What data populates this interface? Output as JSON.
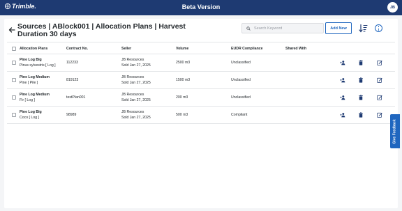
{
  "header": {
    "logo_text": "Trimble.",
    "app_title": "Beta Version",
    "avatar_initials": "JB"
  },
  "page": {
    "title": "Sources | ABlock001 | Allocation Plans | Harvest Duration 30 days",
    "search_placeholder": "Search Keyword",
    "add_button_label": "Add New"
  },
  "table": {
    "columns": {
      "plans": "Allocation Plans",
      "contract": "Contract No.",
      "seller": "Seller",
      "volume": "Volume",
      "eudr": "EUDR Compliance",
      "shared": "Shared With"
    },
    "rows": [
      {
        "name": "Pine Log Big",
        "species": "Pinus sylvestris [ Log ]",
        "contract": "112233",
        "seller": "JB Resources",
        "sold": "Sold Jan 27, 2025",
        "volume": "2500 m3",
        "eudr": "Unclassified",
        "shared": ""
      },
      {
        "name": "Pine Log Medium",
        "species": "Pine [ Pile ]",
        "contract": "819123",
        "seller": "JB Resources",
        "sold": "Sold Jan 27, 2025",
        "volume": "1500 m3",
        "eudr": "Unclassified",
        "shared": ""
      },
      {
        "name": "Pine Log Medium",
        "species": "Fir [ Log ]",
        "contract": "testPlan001",
        "seller": "JB Resources",
        "sold": "Sold Jan 27, 2025",
        "volume": "200 m3",
        "eudr": "Unclassified",
        "shared": ""
      },
      {
        "name": "Pine Log Big",
        "species": "Coco [ Log ]",
        "contract": "98989",
        "seller": "JB Resources",
        "sold": "Sold Jan 27, 2025",
        "volume": "500 m3",
        "eudr": "Compliant",
        "shared": ""
      }
    ]
  },
  "feedback_label": "Give Feedback",
  "icons": {
    "back": "arrow-left-icon",
    "search": "search-icon",
    "sort": "sort-icon",
    "more": "more-vertical-icon",
    "share": "add-person-icon",
    "delete": "trash-icon",
    "edit": "edit-icon"
  },
  "colors": {
    "header_bg": "#1e3a72",
    "accent": "#1f66bf",
    "action_icon": "#1e3a72"
  }
}
